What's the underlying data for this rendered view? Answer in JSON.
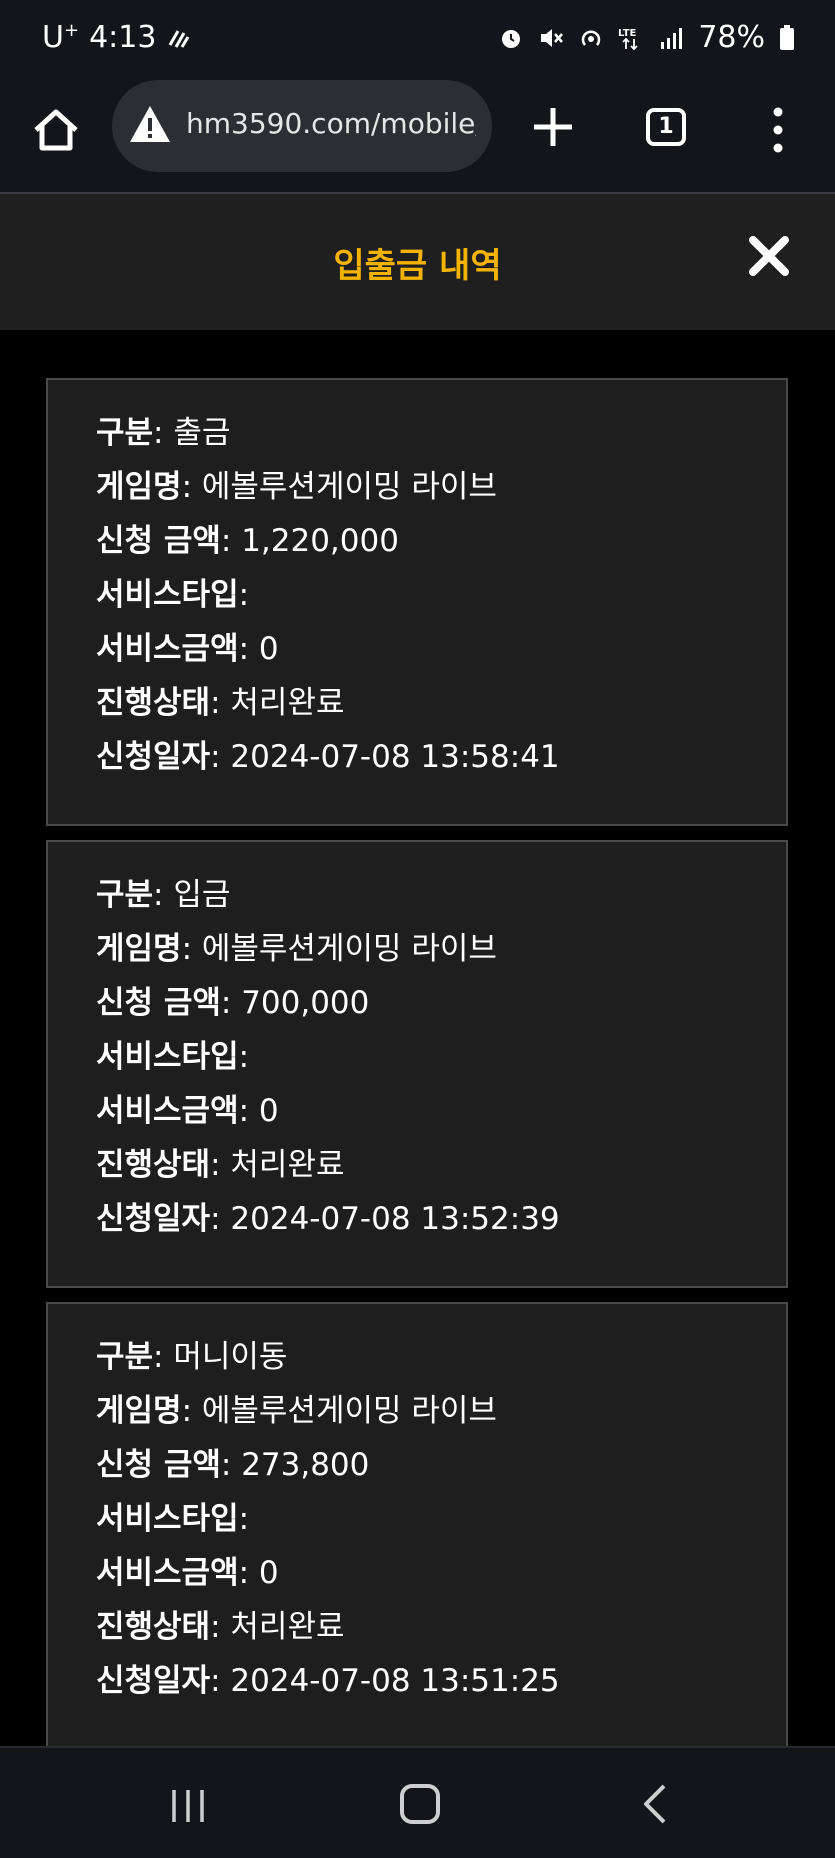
{
  "status_bar": {
    "carrier": "U",
    "carrier_sup": "+",
    "time": "4:13",
    "battery": "78%",
    "icons": [
      "nfc-icon",
      "alarm-icon",
      "mute-icon",
      "hotspot-icon",
      "lte-icon",
      "signal-icon",
      "battery-icon"
    ]
  },
  "browser": {
    "url": "hm3590.com/mobile/",
    "tab_count": "1",
    "icons": [
      "home-icon",
      "warning-icon",
      "plus-icon",
      "tabs-icon",
      "menu-icon"
    ]
  },
  "page": {
    "title": "입출금 내역"
  },
  "labels": {
    "type": "구분",
    "game": "게임명",
    "amount": "신청 금액",
    "service_type": "서비스타입",
    "service_amount": "서비스금액",
    "status": "진행상태",
    "date": "신청일자"
  },
  "records": [
    {
      "type": "출금",
      "game": "에볼루션게이밍 라이브",
      "amount": "1,220,000",
      "service_type": "",
      "service_amount": "0",
      "status": "처리완료",
      "date": "2024-07-08 13:58:41"
    },
    {
      "type": "입금",
      "game": "에볼루션게이밍 라이브",
      "amount": "700,000",
      "service_type": "",
      "service_amount": "0",
      "status": "처리완료",
      "date": "2024-07-08 13:52:39"
    },
    {
      "type": "머니이동",
      "game": "에볼루션게이밍 라이브",
      "amount": "273,800",
      "service_type": "",
      "service_amount": "0",
      "status": "처리완료",
      "date": "2024-07-08 13:51:25"
    }
  ],
  "colors": {
    "accent": "#f5b301",
    "card_bg": "#1e1e1e",
    "header_bg": "#1f1f1f"
  }
}
